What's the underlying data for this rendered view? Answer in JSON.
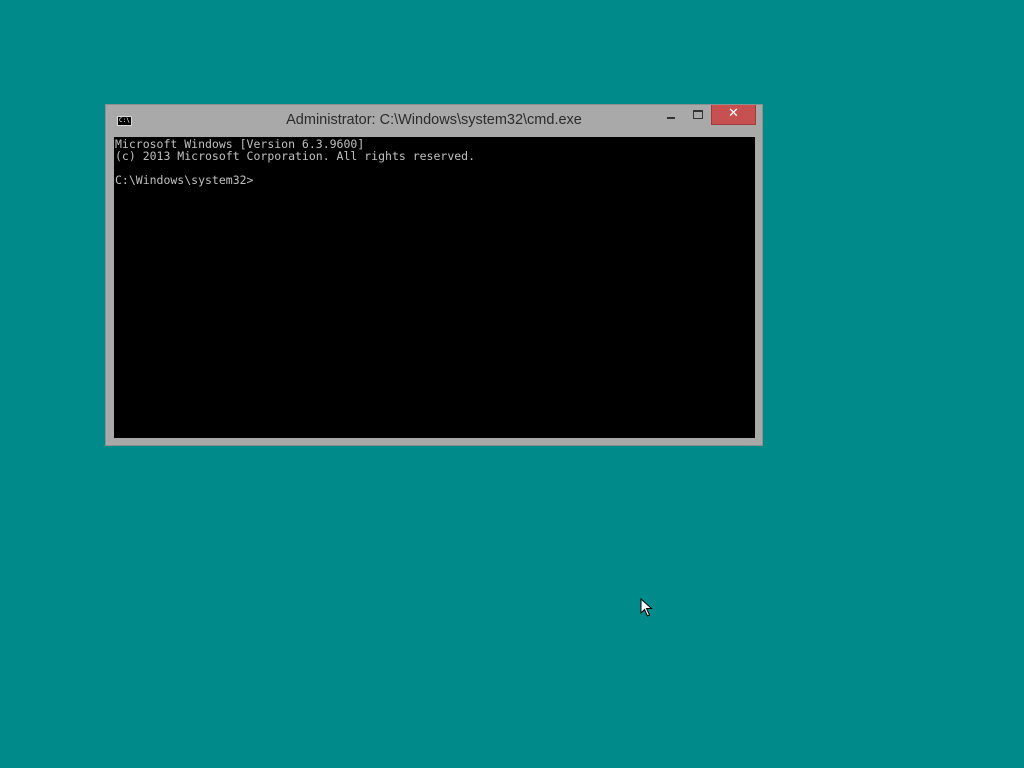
{
  "window": {
    "title": "Administrator: C:\\Windows\\system32\\cmd.exe",
    "icon": "cmd-icon",
    "icon_text": "C:\\",
    "minimize_icon": "minimize-icon",
    "maximize_icon": "maximize-icon",
    "close_label": "✕"
  },
  "console": {
    "lines": [
      "Microsoft Windows [Version 6.3.9600]",
      "(c) 2013 Microsoft Corporation. All rights reserved.",
      "",
      "C:\\Windows\\system32>"
    ]
  },
  "colors": {
    "desktop": "#018a8a",
    "window_frame": "#a9a9a9",
    "close_button": "#c75050",
    "console_bg": "#000000",
    "console_text": "#c0c0c0"
  }
}
